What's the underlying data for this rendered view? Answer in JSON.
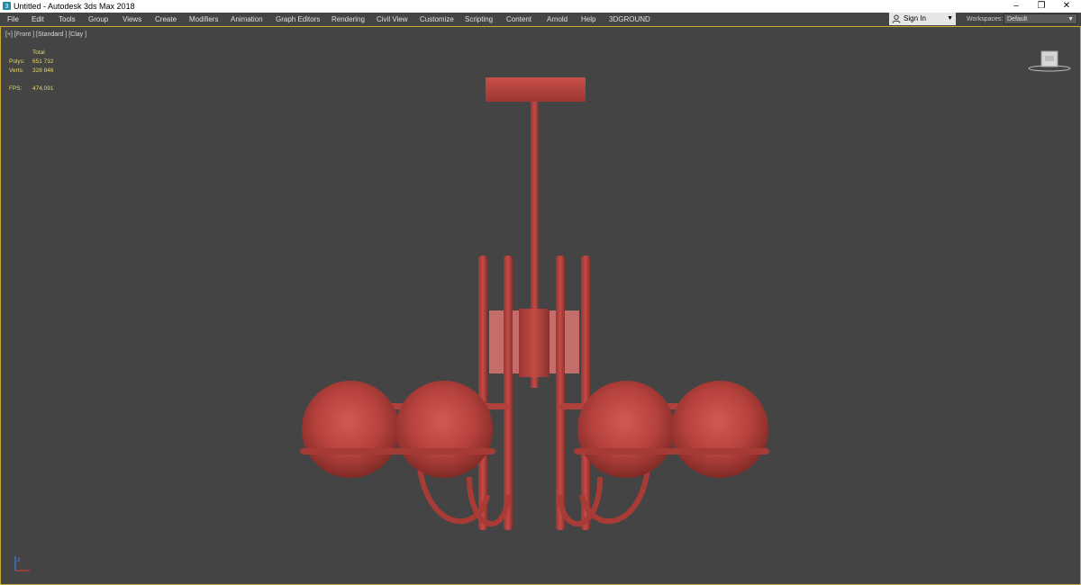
{
  "window": {
    "title": "Untitled - Autodesk 3ds Max 2018",
    "icon": "3dsmax-app-icon",
    "controls": [
      "–",
      "❐",
      "✕"
    ]
  },
  "menubar": {
    "items": [
      "File",
      "Edit",
      "Tools",
      "Group",
      "Views",
      "Create",
      "Modifiers",
      "Animation",
      "Graph Editors",
      "Rendering",
      "Civil View",
      "Customize",
      "Scripting",
      "Content",
      "Arnold",
      "Help",
      "3DGROUND"
    ]
  },
  "account": {
    "sign_in": "Sign In",
    "icon": "user-icon"
  },
  "workspaces": {
    "label": "Workspaces:",
    "value": "Default"
  },
  "viewport": {
    "label": "[+] [Front ] [Standard ] [Clay ]",
    "stats": {
      "header": "Total",
      "polys_label": "Polys:",
      "polys": "651 732",
      "verts_label": "Verts:",
      "verts": "328 846",
      "fps_label": "FPS:",
      "fps": "474,091"
    },
    "scene_object": "chandelier",
    "colors": {
      "object": "#b8433f",
      "frame": "#c8a93a",
      "background": "#444444",
      "stats": "#e2d86a"
    }
  }
}
